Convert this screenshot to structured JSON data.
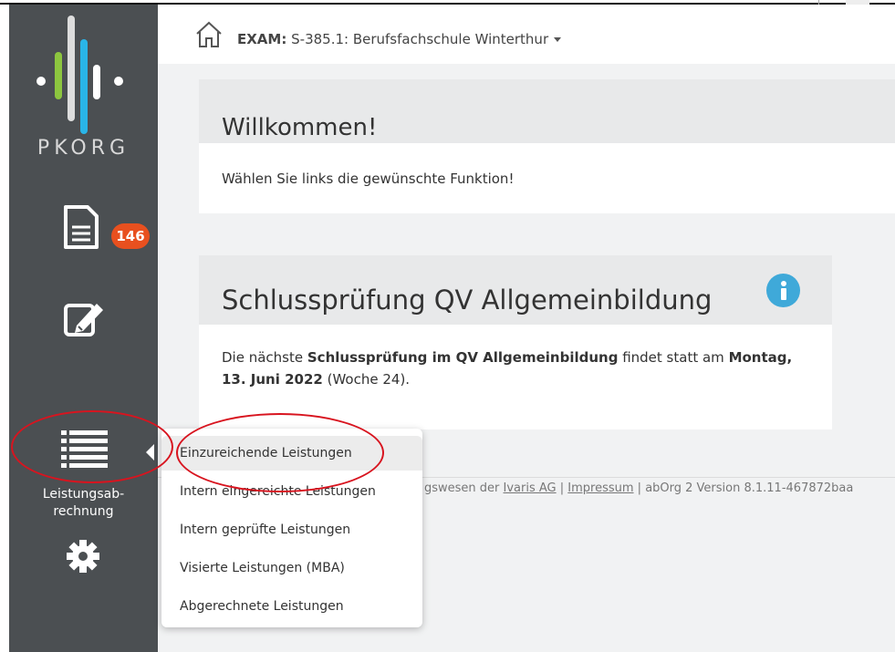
{
  "sidebar": {
    "logo_text": "PKORG",
    "badge_count": "146",
    "active_label_line1": "Leistungsab-",
    "active_label_line2": "rechnung",
    "icons": [
      "document-icon",
      "edit-icon",
      "list-icon",
      "gear-icon"
    ]
  },
  "topbar": {
    "exam_prefix": "EXAM:",
    "exam_value": "S-385.1: Berufsfachschule Winterthur"
  },
  "welcome_card": {
    "title": "Willkommen!",
    "text": "Wählen Sie links die gewünschte Funktion!"
  },
  "info_card": {
    "title": "Schlussprüfung QV Allgemeinbildung",
    "text_1": "Die nächste ",
    "text_bold_1": "Schlussprüfung im QV Allgemeinbildung",
    "text_2": " findet statt am ",
    "text_bold_2": "Montag, 13. Juni 2022",
    "text_3": " (Woche 24)."
  },
  "footer": {
    "text_1": "gswesen der ",
    "link_1": "Ivaris AG",
    "sep_1": " | ",
    "link_2": "Impressum",
    "text_2": " | abOrg 2 Version 8.1.11-467872baa"
  },
  "menu": {
    "items": [
      {
        "label": "Einzureichende Leistungen"
      },
      {
        "label": "Intern eingereichte Leistungen"
      },
      {
        "label": "Intern geprüfte Leistungen"
      },
      {
        "label": "Visierte Leistungen (MBA)"
      },
      {
        "label": "Abgerechnete Leistungen"
      }
    ]
  },
  "colors": {
    "sidebar": "#4b4f52",
    "badge": "#e8501f",
    "info": "#3fa9d9",
    "annotation": "#d8141f"
  }
}
